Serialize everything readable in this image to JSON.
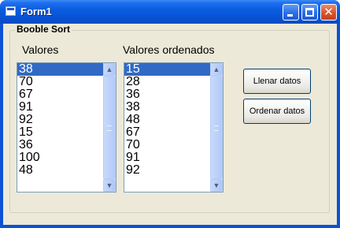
{
  "window": {
    "title": "Form1"
  },
  "group": {
    "title": "Booble Sort"
  },
  "labels": {
    "valores": "Valores",
    "ordenados": "Valores ordenados"
  },
  "lists": {
    "valores": [
      "38",
      "70",
      "67",
      "91",
      "92",
      "15",
      "36",
      "100",
      "48"
    ],
    "ordenados": [
      "15",
      "28",
      "36",
      "38",
      "48",
      "67",
      "70",
      "91",
      "92"
    ]
  },
  "buttons": {
    "llenar": "Llenar datos",
    "ordenar": "Ordenar datos"
  },
  "close_glyph": "✕"
}
